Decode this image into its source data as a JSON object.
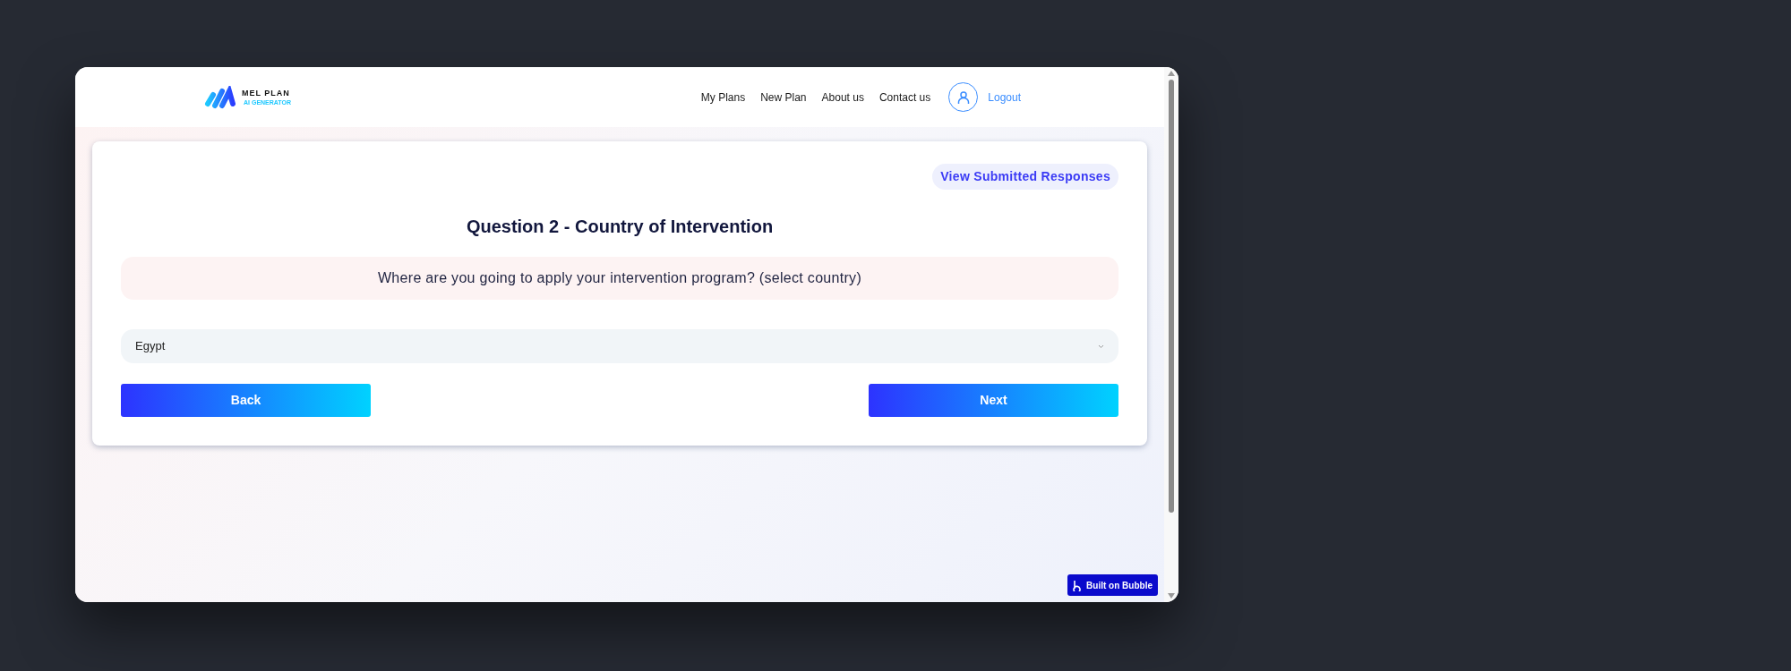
{
  "logo": {
    "name": "MEL PLAN",
    "tagline": "AI GENERATOR"
  },
  "nav": {
    "links": [
      "My Plans",
      "New Plan",
      "About us",
      "Contact us"
    ],
    "logout": "Logout"
  },
  "card": {
    "responses_link": "View Submitted Responses",
    "title": "Question 2 - Country of Intervention",
    "question": "Where are you going to apply your intervention program? (select country)",
    "select": {
      "value": "Egypt"
    },
    "buttons": [
      "Back",
      "Next"
    ]
  },
  "badge": "Built on Bubble"
}
